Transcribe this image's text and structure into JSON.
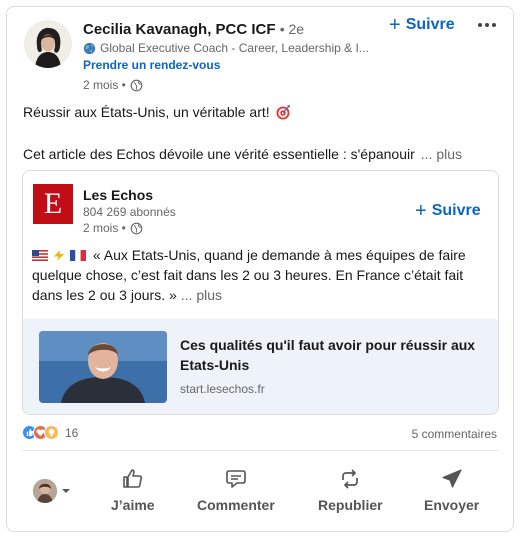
{
  "post": {
    "author_name": "Cecilia Kavanagh, PCC ICF",
    "author_degree": "• 2e",
    "author_headline": "Global Executive Coach - Career, Leadership & I...",
    "author_link": "Prendre un rendez-vous",
    "time": "2 mois •",
    "follow_label": "Suivre",
    "title": "Réussir aux États-Unis, un véritable art!",
    "body": "Cet article des Echos dévoile une vérité essentielle : s'épanouir",
    "see_more": "... plus"
  },
  "shared": {
    "source_name": "Les Echos",
    "source_logo_letter": "E",
    "followers": "804 269 abonnés",
    "time": "2 mois •",
    "follow_label": "Suivre",
    "text": "« Aux Etats-Unis, quand je demande à mes équipes de faire quelque chose, c’est fait dans les 2 ou 3 heures. En France c’était fait dans les 2 ou 3 jours. »",
    "see_more": "... plus",
    "article_title": "Ces qualités qu'il faut avoir pour réussir aux Etats-Unis",
    "article_domain": "start.lesechos.fr"
  },
  "social": {
    "reaction_count": "16",
    "comments": "5 commentaires"
  },
  "actions": {
    "like": "J’aime",
    "comment": "Commenter",
    "repost": "Republier",
    "send": "Envoyer"
  },
  "colors": {
    "accent": "#0a66c2",
    "echos_red": "#c00d16",
    "article_bg": "#edf3f8"
  },
  "icons": [
    "globe-icon",
    "target-icon",
    "like-icon",
    "comment-icon",
    "repost-icon",
    "send-icon",
    "more-icon",
    "chevron-down-icon"
  ]
}
